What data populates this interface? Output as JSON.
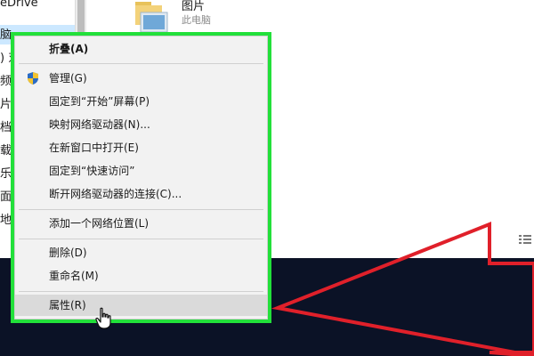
{
  "nav": {
    "onedrive_label": "eDrive",
    "items": [
      {
        "label": "脑"
      },
      {
        "label": ") 对"
      },
      {
        "label": "频"
      },
      {
        "label": "片"
      },
      {
        "label": "档"
      },
      {
        "label": "载"
      },
      {
        "label": "乐"
      },
      {
        "label": "面"
      },
      {
        "label": "地"
      }
    ]
  },
  "content": {
    "pictures_name": "图片",
    "pictures_sub": "此电脑"
  },
  "menu": {
    "items": [
      {
        "label": "折叠(A)",
        "bold": true
      },
      {
        "label": "管理(G)",
        "icon": "shield-icon"
      },
      {
        "label": "固定到“开始”屏幕(P)"
      },
      {
        "label": "映射网络驱动器(N)..."
      },
      {
        "label": "在新窗口中打开(E)"
      },
      {
        "label": "固定到“快速访问”"
      },
      {
        "label": "断开网络驱动器的连接(C)..."
      },
      {
        "label": "添加一个网络位置(L)"
      },
      {
        "label": "删除(D)"
      },
      {
        "label": "重命名(M)"
      },
      {
        "label": "属性(R)",
        "hover": true
      }
    ]
  },
  "colors": {
    "highlight_box": "#22e03a",
    "arrow": "#e0202a",
    "menu_bg": "#f2f2f2",
    "desktop": "#0b1226"
  },
  "icons": [
    "shield-icon",
    "folder-icon",
    "cursor-hand-icon",
    "view-toggle-icon"
  ]
}
